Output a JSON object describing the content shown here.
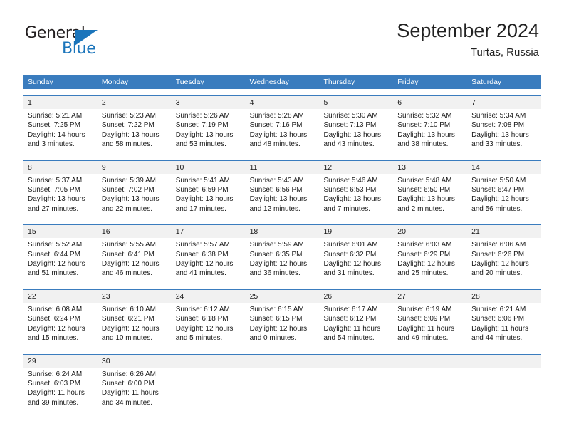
{
  "brand": {
    "name_top": "General",
    "name_bottom": "Blue",
    "accent_color": "#1b75bb"
  },
  "header": {
    "title": "September 2024",
    "subtitle": "Turtas, Russia"
  },
  "theme": {
    "header_bar_color": "#3a7cbe",
    "daynum_band_color": "#f1f1f1",
    "text_color": "#1a1a1a"
  },
  "weekdays": [
    "Sunday",
    "Monday",
    "Tuesday",
    "Wednesday",
    "Thursday",
    "Friday",
    "Saturday"
  ],
  "weeks": [
    {
      "days": [
        {
          "num": "1",
          "lines": [
            "Sunrise: 5:21 AM",
            "Sunset: 7:25 PM",
            "Daylight: 14 hours",
            "and 3 minutes."
          ]
        },
        {
          "num": "2",
          "lines": [
            "Sunrise: 5:23 AM",
            "Sunset: 7:22 PM",
            "Daylight: 13 hours",
            "and 58 minutes."
          ]
        },
        {
          "num": "3",
          "lines": [
            "Sunrise: 5:26 AM",
            "Sunset: 7:19 PM",
            "Daylight: 13 hours",
            "and 53 minutes."
          ]
        },
        {
          "num": "4",
          "lines": [
            "Sunrise: 5:28 AM",
            "Sunset: 7:16 PM",
            "Daylight: 13 hours",
            "and 48 minutes."
          ]
        },
        {
          "num": "5",
          "lines": [
            "Sunrise: 5:30 AM",
            "Sunset: 7:13 PM",
            "Daylight: 13 hours",
            "and 43 minutes."
          ]
        },
        {
          "num": "6",
          "lines": [
            "Sunrise: 5:32 AM",
            "Sunset: 7:10 PM",
            "Daylight: 13 hours",
            "and 38 minutes."
          ]
        },
        {
          "num": "7",
          "lines": [
            "Sunrise: 5:34 AM",
            "Sunset: 7:08 PM",
            "Daylight: 13 hours",
            "and 33 minutes."
          ]
        }
      ]
    },
    {
      "days": [
        {
          "num": "8",
          "lines": [
            "Sunrise: 5:37 AM",
            "Sunset: 7:05 PM",
            "Daylight: 13 hours",
            "and 27 minutes."
          ]
        },
        {
          "num": "9",
          "lines": [
            "Sunrise: 5:39 AM",
            "Sunset: 7:02 PM",
            "Daylight: 13 hours",
            "and 22 minutes."
          ]
        },
        {
          "num": "10",
          "lines": [
            "Sunrise: 5:41 AM",
            "Sunset: 6:59 PM",
            "Daylight: 13 hours",
            "and 17 minutes."
          ]
        },
        {
          "num": "11",
          "lines": [
            "Sunrise: 5:43 AM",
            "Sunset: 6:56 PM",
            "Daylight: 13 hours",
            "and 12 minutes."
          ]
        },
        {
          "num": "12",
          "lines": [
            "Sunrise: 5:46 AM",
            "Sunset: 6:53 PM",
            "Daylight: 13 hours",
            "and 7 minutes."
          ]
        },
        {
          "num": "13",
          "lines": [
            "Sunrise: 5:48 AM",
            "Sunset: 6:50 PM",
            "Daylight: 13 hours",
            "and 2 minutes."
          ]
        },
        {
          "num": "14",
          "lines": [
            "Sunrise: 5:50 AM",
            "Sunset: 6:47 PM",
            "Daylight: 12 hours",
            "and 56 minutes."
          ]
        }
      ]
    },
    {
      "days": [
        {
          "num": "15",
          "lines": [
            "Sunrise: 5:52 AM",
            "Sunset: 6:44 PM",
            "Daylight: 12 hours",
            "and 51 minutes."
          ]
        },
        {
          "num": "16",
          "lines": [
            "Sunrise: 5:55 AM",
            "Sunset: 6:41 PM",
            "Daylight: 12 hours",
            "and 46 minutes."
          ]
        },
        {
          "num": "17",
          "lines": [
            "Sunrise: 5:57 AM",
            "Sunset: 6:38 PM",
            "Daylight: 12 hours",
            "and 41 minutes."
          ]
        },
        {
          "num": "18",
          "lines": [
            "Sunrise: 5:59 AM",
            "Sunset: 6:35 PM",
            "Daylight: 12 hours",
            "and 36 minutes."
          ]
        },
        {
          "num": "19",
          "lines": [
            "Sunrise: 6:01 AM",
            "Sunset: 6:32 PM",
            "Daylight: 12 hours",
            "and 31 minutes."
          ]
        },
        {
          "num": "20",
          "lines": [
            "Sunrise: 6:03 AM",
            "Sunset: 6:29 PM",
            "Daylight: 12 hours",
            "and 25 minutes."
          ]
        },
        {
          "num": "21",
          "lines": [
            "Sunrise: 6:06 AM",
            "Sunset: 6:26 PM",
            "Daylight: 12 hours",
            "and 20 minutes."
          ]
        }
      ]
    },
    {
      "days": [
        {
          "num": "22",
          "lines": [
            "Sunrise: 6:08 AM",
            "Sunset: 6:24 PM",
            "Daylight: 12 hours",
            "and 15 minutes."
          ]
        },
        {
          "num": "23",
          "lines": [
            "Sunrise: 6:10 AM",
            "Sunset: 6:21 PM",
            "Daylight: 12 hours",
            "and 10 minutes."
          ]
        },
        {
          "num": "24",
          "lines": [
            "Sunrise: 6:12 AM",
            "Sunset: 6:18 PM",
            "Daylight: 12 hours",
            "and 5 minutes."
          ]
        },
        {
          "num": "25",
          "lines": [
            "Sunrise: 6:15 AM",
            "Sunset: 6:15 PM",
            "Daylight: 12 hours",
            "and 0 minutes."
          ]
        },
        {
          "num": "26",
          "lines": [
            "Sunrise: 6:17 AM",
            "Sunset: 6:12 PM",
            "Daylight: 11 hours",
            "and 54 minutes."
          ]
        },
        {
          "num": "27",
          "lines": [
            "Sunrise: 6:19 AM",
            "Sunset: 6:09 PM",
            "Daylight: 11 hours",
            "and 49 minutes."
          ]
        },
        {
          "num": "28",
          "lines": [
            "Sunrise: 6:21 AM",
            "Sunset: 6:06 PM",
            "Daylight: 11 hours",
            "and 44 minutes."
          ]
        }
      ]
    },
    {
      "days": [
        {
          "num": "29",
          "lines": [
            "Sunrise: 6:24 AM",
            "Sunset: 6:03 PM",
            "Daylight: 11 hours",
            "and 39 minutes."
          ]
        },
        {
          "num": "30",
          "lines": [
            "Sunrise: 6:26 AM",
            "Sunset: 6:00 PM",
            "Daylight: 11 hours",
            "and 34 minutes."
          ]
        },
        {
          "num": "",
          "lines": []
        },
        {
          "num": "",
          "lines": []
        },
        {
          "num": "",
          "lines": []
        },
        {
          "num": "",
          "lines": []
        },
        {
          "num": "",
          "lines": []
        }
      ]
    }
  ]
}
